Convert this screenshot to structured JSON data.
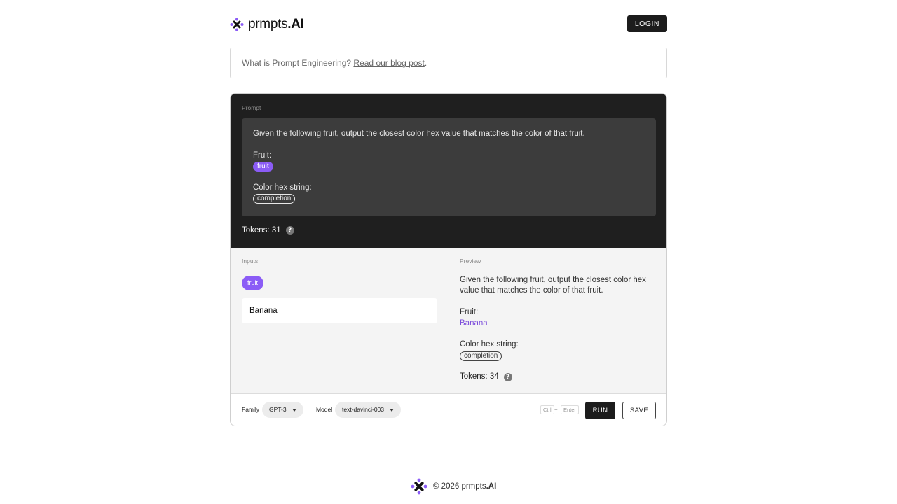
{
  "brand": {
    "name": "prmpts",
    "suffix": ".AI",
    "accent_color": "#8b5cf6"
  },
  "header": {
    "login_label": "LOGIN"
  },
  "info": {
    "text": "What is Prompt Engineering?",
    "link_text": "Read our blog post",
    "trailing": "."
  },
  "prompt": {
    "label": "Prompt",
    "line1": "Given the following fruit, output the closest color hex value that matches the color of that fruit.",
    "fruit_label": "Fruit:",
    "fruit_var": "fruit",
    "color_label": "Color hex string:",
    "completion_tag": "completion",
    "tokens_label": "Tokens: 31",
    "help_icon": "?"
  },
  "inputs": {
    "label": "Inputs",
    "chip": "fruit",
    "value": "Banana"
  },
  "preview": {
    "label": "Preview",
    "line1": "Given the following fruit, output the closest color hex value that matches the color of that fruit.",
    "fruit_label": "Fruit:",
    "fruit_value": "Banana",
    "color_label": "Color hex string:",
    "completion_tag": "completion",
    "tokens_label": "Tokens: 34",
    "help_icon": "?"
  },
  "toolbar": {
    "family_label": "Family",
    "family_value": "GPT-3",
    "model_label": "Model",
    "model_value": "text-davinci-003",
    "shortcut_ctrl": "Ctrl",
    "shortcut_plus": "+",
    "shortcut_enter": "Enter",
    "run_label": "RUN",
    "save_label": "SAVE"
  },
  "footer": {
    "copyright": "© 2026 prmpts",
    "suffix": ".AI"
  }
}
